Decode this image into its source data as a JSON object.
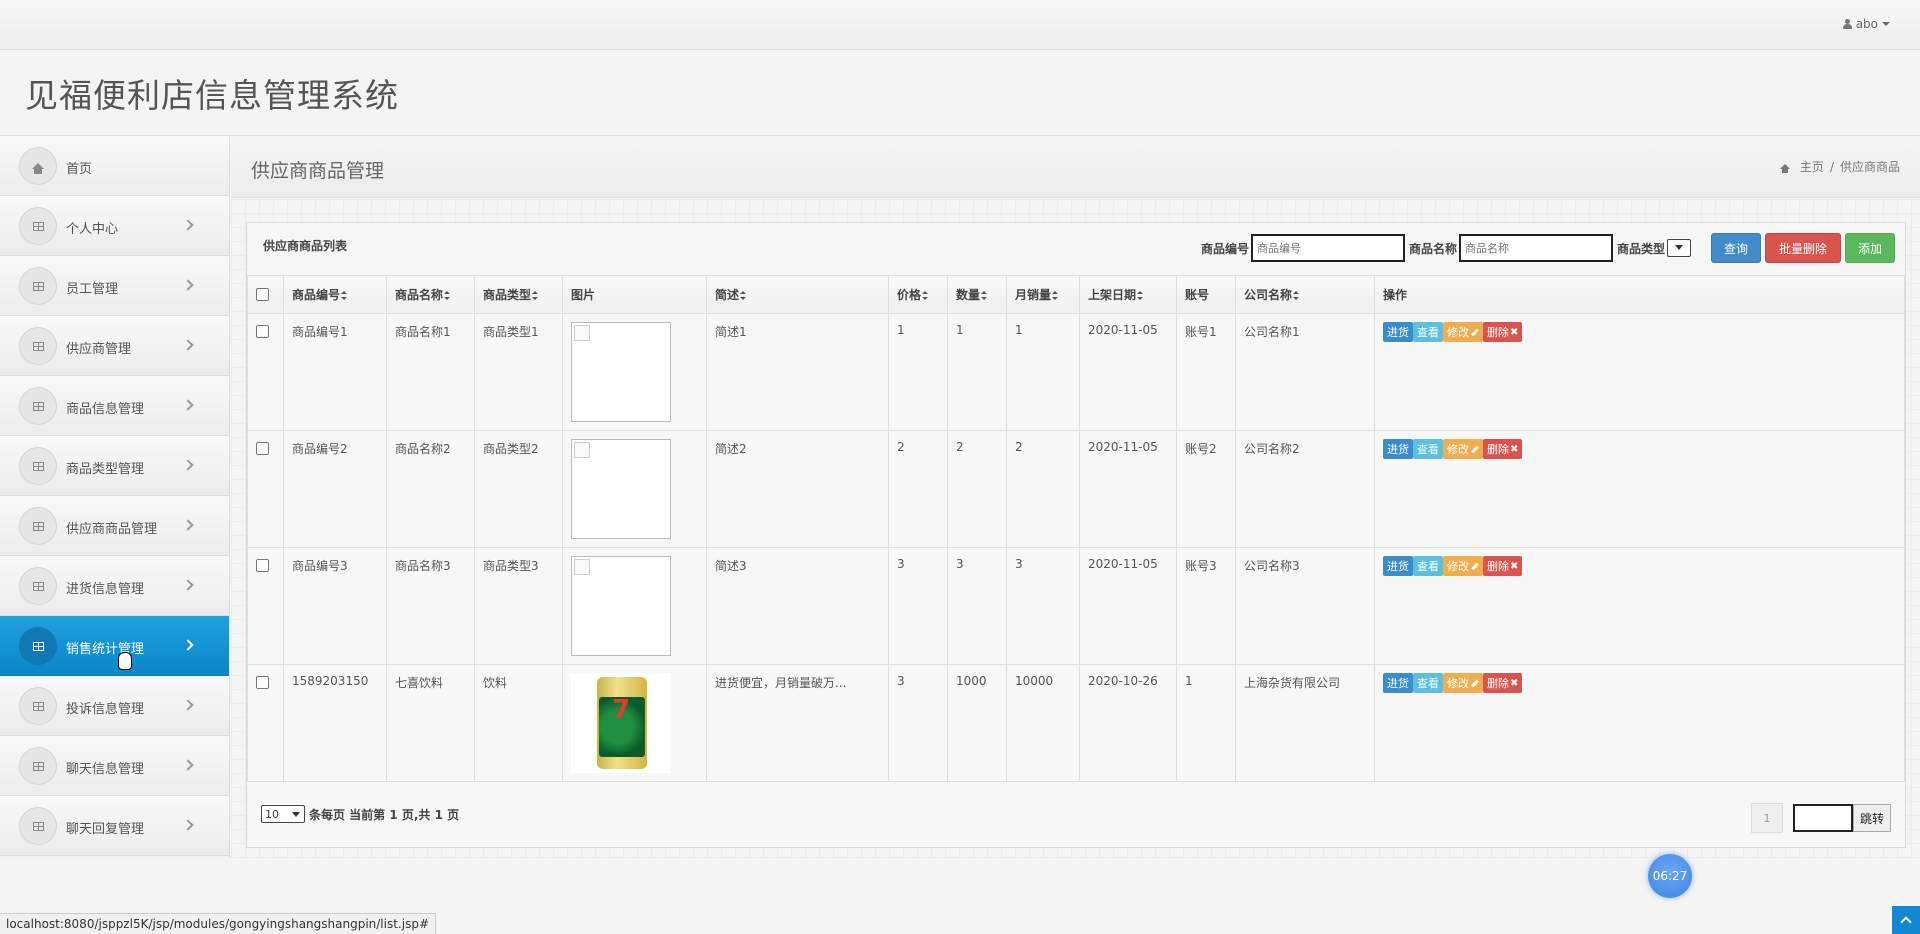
{
  "topbar": {
    "user_name": "abo"
  },
  "header": {
    "app_title": "见福便利店信息管理系统"
  },
  "sidebar": {
    "items": [
      {
        "label": "首页",
        "icon": "home-icon",
        "active": false
      },
      {
        "label": "个人中心",
        "icon": "grid-icon",
        "active": false
      },
      {
        "label": "员工管理",
        "icon": "grid-icon",
        "active": false
      },
      {
        "label": "供应商管理",
        "icon": "grid-icon",
        "active": false
      },
      {
        "label": "商品信息管理",
        "icon": "grid-icon",
        "active": false
      },
      {
        "label": "商品类型管理",
        "icon": "grid-icon",
        "active": false
      },
      {
        "label": "供应商商品管理",
        "icon": "grid-icon",
        "active": false
      },
      {
        "label": "进货信息管理",
        "icon": "grid-icon",
        "active": false
      },
      {
        "label": "销售统计管理",
        "icon": "grid-icon",
        "active": true
      },
      {
        "label": "投诉信息管理",
        "icon": "grid-icon",
        "active": false
      },
      {
        "label": "聊天信息管理",
        "icon": "grid-icon",
        "active": false
      },
      {
        "label": "聊天回复管理",
        "icon": "grid-icon",
        "active": false
      }
    ]
  },
  "page": {
    "title": "供应商商品管理",
    "breadcrumb_home": "主页",
    "breadcrumb_sep": "/",
    "breadcrumb_current": "供应商商品"
  },
  "panel": {
    "title": "供应商商品列表",
    "filters": {
      "code_label": "商品编号",
      "code_placeholder": "商品编号",
      "name_label": "商品名称",
      "name_placeholder": "商品名称",
      "type_label": "商品类型"
    },
    "buttons": {
      "query": "查询",
      "batch_delete": "批量删除",
      "add": "添加"
    }
  },
  "table": {
    "columns": [
      "商品编号",
      "商品名称",
      "商品类型",
      "图片",
      "简述",
      "价格",
      "数量",
      "月销量",
      "上架日期",
      "账号",
      "公司名称",
      "操作"
    ],
    "rows": [
      {
        "code": "商品编号1",
        "name": "商品名称1",
        "type": "商品类型1",
        "image": "broken",
        "desc": "简述1",
        "price": "1",
        "qty": "1",
        "monthly": "1",
        "date": "2020-11-05",
        "account": "账号1",
        "company": "公司名称1"
      },
      {
        "code": "商品编号2",
        "name": "商品名称2",
        "type": "商品类型2",
        "image": "broken",
        "desc": "简述2",
        "price": "2",
        "qty": "2",
        "monthly": "2",
        "date": "2020-11-05",
        "account": "账号2",
        "company": "公司名称2"
      },
      {
        "code": "商品编号3",
        "name": "商品名称3",
        "type": "商品类型3",
        "image": "broken",
        "desc": "简述3",
        "price": "3",
        "qty": "3",
        "monthly": "3",
        "date": "2020-11-05",
        "account": "账号3",
        "company": "公司名称3"
      },
      {
        "code": "1589203150",
        "name": "七喜饮料",
        "type": "饮料",
        "image": "can",
        "desc": "进货便宜，月销量破万...",
        "price": "3",
        "qty": "1000",
        "monthly": "10000",
        "date": "2020-10-26",
        "account": "1",
        "company": "上海杂货有限公司"
      }
    ],
    "row_actions": {
      "stock_in": "进货",
      "view": "查看",
      "edit": "修改",
      "delete": "删除"
    }
  },
  "footer": {
    "page_size": "10",
    "page_info": "条每页 当前第 1 页,共 1 页",
    "current_page": "1",
    "jump_label": "跳转"
  },
  "clock": {
    "time": "06:27"
  },
  "status_bar": {
    "url": "localhost:8080/jsppzl5K/jsp/modules/gongyingshangshangpin/list.jsp#"
  },
  "colors": {
    "accent": "#0a86c9",
    "query": "#428bca",
    "danger": "#d9534f",
    "success": "#5cb85c",
    "warning": "#f0ad4e",
    "info": "#5bc0de"
  }
}
